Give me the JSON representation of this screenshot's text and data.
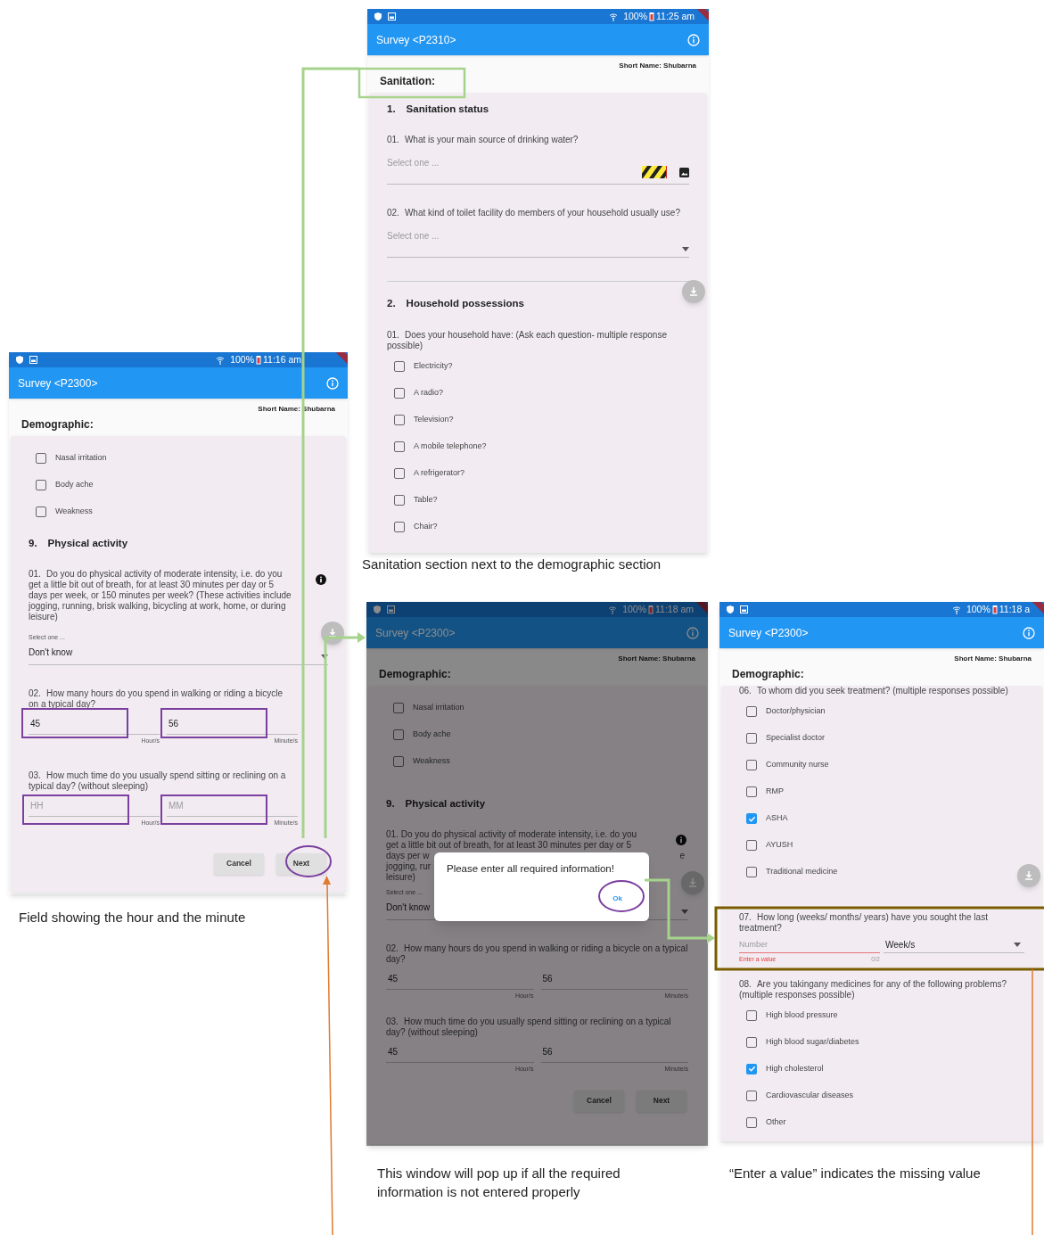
{
  "phones": [
    {
      "status": {
        "battery": "100%",
        "time": "11:25 am"
      },
      "title": "Survey <P2310>",
      "short_name": "Short Name: Shubarna",
      "section": "Sanitation:",
      "dimmed": false,
      "blocks": [
        {
          "kind": "heading",
          "number": "1.",
          "text": "Sanitation status"
        },
        {
          "kind": "select",
          "number": "01.",
          "question": "What is your main source of drinking water?",
          "placeholder": "Select one ...",
          "trailing": {
            "kind": "overflow"
          }
        },
        {
          "kind": "select",
          "number": "02.",
          "question": "What kind of toilet facility do members of your household usually use?",
          "placeholder": "Select one ...",
          "trailing": {
            "kind": "arrow"
          }
        },
        {
          "kind": "divider"
        },
        {
          "kind": "heading",
          "number": "2.",
          "text": "Household possessions"
        },
        {
          "kind": "checkboxes",
          "number": "01.",
          "question": "Does your household have: (Ask each question- multiple response possible)",
          "options": [
            {
              "label": "Electricity?",
              "checked": false
            },
            {
              "label": "A radio?",
              "checked": false
            },
            {
              "label": "Television?",
              "checked": false
            },
            {
              "label": "A mobile telephone?",
              "checked": false
            },
            {
              "label": "A refrigerator?",
              "checked": false
            },
            {
              "label": "Table?",
              "checked": false
            },
            {
              "label": "Chair?",
              "checked": false
            }
          ]
        }
      ]
    },
    {
      "status": {
        "battery": "100%",
        "time": "11:16 am"
      },
      "title": "Survey <P2300>",
      "short_name": "Short Name: Shubarna",
      "section": "Demographic:",
      "dimmed": false,
      "blocks": [
        {
          "kind": "checkboxes",
          "options": [
            {
              "label": "Nasal irritation",
              "checked": false
            },
            {
              "label": "Body ache",
              "checked": false
            },
            {
              "label": "Weakness",
              "checked": false
            }
          ]
        },
        {
          "kind": "heading",
          "number": "9.",
          "text": "Physical activity"
        },
        {
          "kind": "select",
          "number": "01.",
          "question": "Do you do physical activity of moderate intensity, i.e. do you get a little bit out of breath, for at least 30 minutes per day or 5 days per week, or 150 minutes per week? (These activities include jogging, running, brisk walking, bicycling at work, home, or during leisure)",
          "info": true,
          "label": "Select one ...",
          "value": "Don't know",
          "trailing": {
            "kind": "arrow"
          }
        },
        {
          "kind": "time",
          "number": "02.",
          "question": "How many hours do you spend in walking or riding a bicycle on a typical day?",
          "hours": {
            "value": "45"
          },
          "minutes": {
            "value": "56"
          },
          "hour_unit": "Hour/s",
          "minute_unit": "Minute/s"
        },
        {
          "kind": "time",
          "number": "03.",
          "question": "How much time do you usually spend sitting or reclining on a typical day? (without sleeping)",
          "hours": {
            "placeholder": "HH"
          },
          "minutes": {
            "placeholder": "MM"
          },
          "hour_unit": "Hour/s",
          "minute_unit": "Minute/s"
        },
        {
          "kind": "buttons",
          "items": [
            "Cancel",
            "Next"
          ]
        }
      ]
    },
    {
      "status": {
        "battery": "100%",
        "time": "11:18 am"
      },
      "title": "Survey <P2300>",
      "short_name": "Short Name: Shubarna",
      "section": "Demographic:",
      "dimmed": true,
      "blocks": [
        {
          "kind": "checkboxes",
          "options": [
            {
              "label": "Nasal irritation",
              "checked": false
            },
            {
              "label": "Body ache",
              "checked": false
            },
            {
              "label": "Weakness",
              "checked": false
            }
          ]
        },
        {
          "kind": "heading",
          "number": "9.",
          "text": "Physical activity"
        },
        {
          "kind": "select",
          "question_lines": [
            {
              "left": "01.  Do you do physical activity of moderate intensity, i.e. do you"
            },
            {
              "left": "get a little bit out of breath, for at least 30 minutes per day or 5"
            },
            {
              "left": "days per w",
              "right": "e"
            },
            {
              "left": "jogging, rur"
            },
            {
              "left": "leisure)"
            }
          ],
          "info": true,
          "label": "Select one ...",
          "value": "Don't know",
          "trailing": {
            "kind": "arrow"
          },
          "dialog": {
            "message": "Please enter all required information!",
            "button": "Ok"
          }
        },
        {
          "kind": "time",
          "number": "02.",
          "question": "How many hours do you spend in walking or riding a bicycle on a typical day?",
          "hours": {
            "value": "45"
          },
          "minutes": {
            "value": "56"
          },
          "hour_unit": "Hour/s",
          "minute_unit": "Minute/s"
        },
        {
          "kind": "time",
          "number": "03.",
          "question": "How much time do you usually spend sitting or reclining on a typical day? (without sleeping)",
          "hours": {
            "value": "45"
          },
          "minutes": {
            "value": "56"
          },
          "hour_unit": "Hour/s",
          "minute_unit": "Minute/s"
        },
        {
          "kind": "buttons",
          "items": [
            "Cancel",
            "Next"
          ]
        }
      ]
    },
    {
      "status": {
        "battery": "100%",
        "time": "11:18 a"
      },
      "title": "Survey <P2300>",
      "short_name": "Short Name: Shubarna",
      "section": "Demographic:",
      "dimmed": false,
      "blocks": [
        {
          "kind": "checkboxes",
          "number": "06.",
          "question": "To whom did you seek treatment? (multiple responses possible)",
          "options": [
            {
              "label": "Doctor/physician",
              "checked": false
            },
            {
              "label": "Specialist doctor",
              "checked": false
            },
            {
              "label": "Community nurse",
              "checked": false
            },
            {
              "label": "RMP",
              "checked": false
            },
            {
              "label": "ASHA",
              "checked": true
            },
            {
              "label": "AYUSH",
              "checked": false
            },
            {
              "label": "Traditional medicine",
              "checked": false
            }
          ]
        },
        {
          "kind": "number_unit",
          "number": "07.",
          "question": "How long (weeks/ months/ years) have you sought the last treatment?",
          "placeholder": "Number",
          "error": "Enter a value",
          "counter": "0/2",
          "unit": "Week/s"
        },
        {
          "kind": "checkboxes",
          "number": "08.",
          "question": "Are you takingany medicines for any of the following problems? (multiple responses possible)",
          "options": [
            {
              "label": "High blood pressure",
              "checked": false
            },
            {
              "label": "High blood sugar/diabetes",
              "checked": false
            },
            {
              "label": "High cholesterol",
              "checked": true
            },
            {
              "label": "Cardiovascular diseases",
              "checked": false
            },
            {
              "label": "Other",
              "checked": false
            }
          ]
        }
      ]
    }
  ],
  "captions": [
    "Sanitation section next to the demographic section",
    "Field showing the hour and the minute",
    "This window will pop up if all the required information is not entered properly",
    "“Enter a value” indicates the missing value"
  ]
}
